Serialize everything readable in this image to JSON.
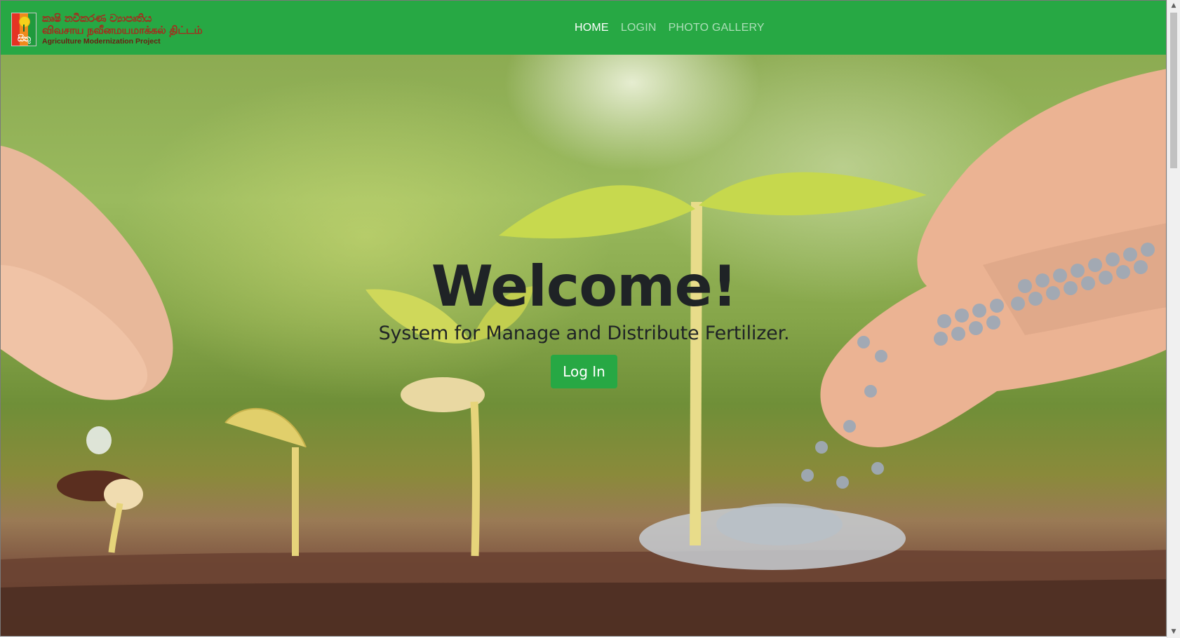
{
  "brand": {
    "logo_script": "සිතු",
    "line1": "කෘෂි නවීකරණ ව්‍යාපෘතිය",
    "line2": "விவசாய நவீனமயமாக்கல் திட்டம்",
    "line3": "Agriculture Modernization Project"
  },
  "nav": {
    "items": [
      {
        "label": "HOME",
        "active": true
      },
      {
        "label": "LOGIN",
        "active": false
      },
      {
        "label": "PHOTO GALLERY",
        "active": false
      }
    ]
  },
  "hero": {
    "title": "Welcome!",
    "subtitle": "System for Manage and Distribute Fertilizer.",
    "button_label": "Log In"
  },
  "colors": {
    "navbar": "#27a844",
    "button": "#27a844",
    "title_text": "#1f2326"
  },
  "icons": {
    "scroll_up": "scroll-up-arrow-icon",
    "scroll_down": "scroll-down-arrow-icon"
  }
}
